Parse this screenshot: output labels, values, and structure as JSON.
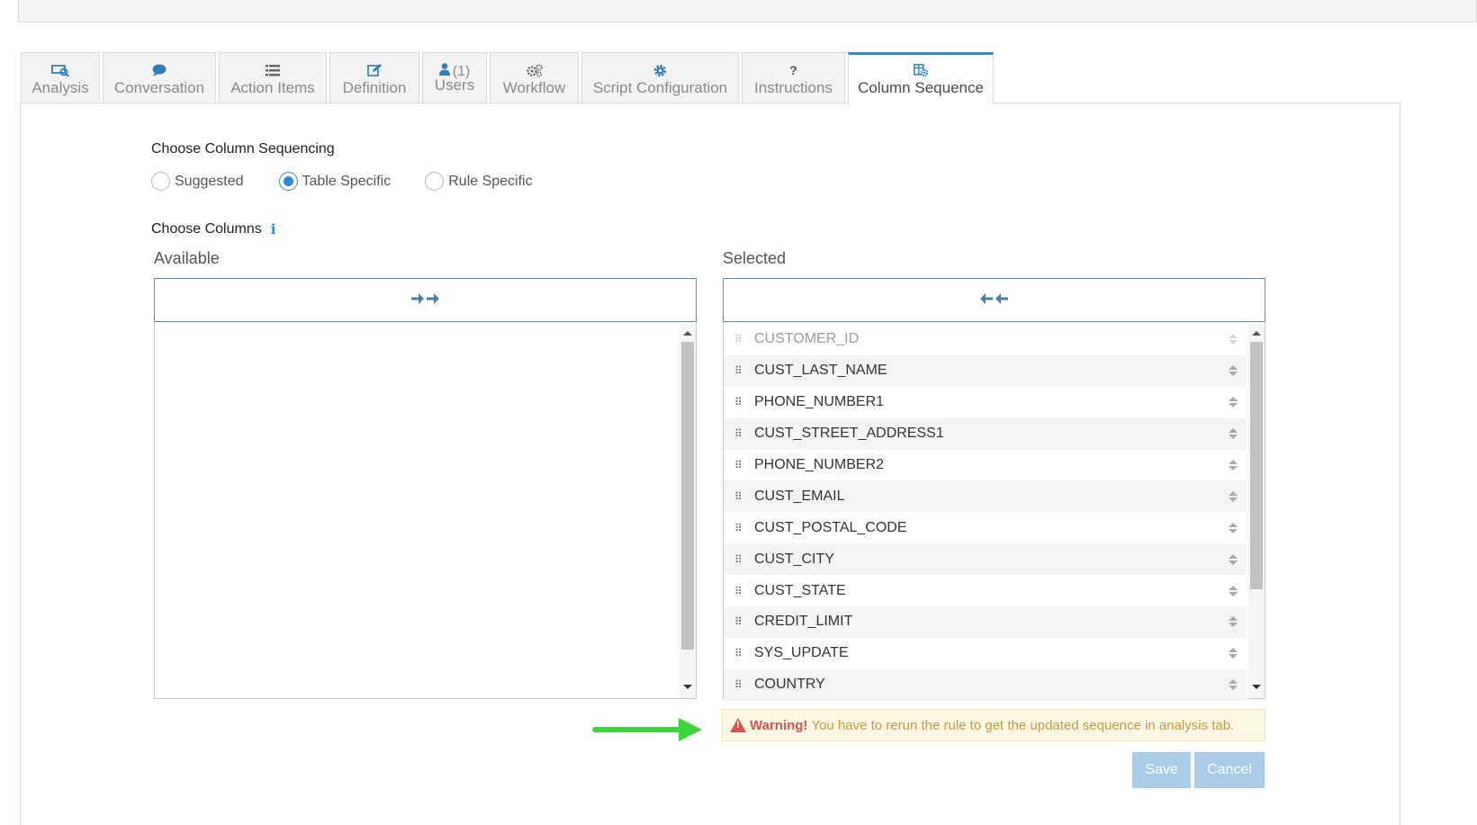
{
  "tabs": [
    {
      "label": "Analysis",
      "icon": "analysis-icon"
    },
    {
      "label": "Conversation",
      "icon": "comment-icon"
    },
    {
      "label": "Action Items",
      "icon": "list-icon"
    },
    {
      "label": "Definition",
      "icon": "edit-icon"
    },
    {
      "label": "Users",
      "icon": "user-icon",
      "count": "(1)"
    },
    {
      "label": "Workflow",
      "icon": "cogs-icon"
    },
    {
      "label": "Script Configuration",
      "icon": "gear-icon"
    },
    {
      "label": "Instructions",
      "icon": "question-icon"
    },
    {
      "label": "Column Sequence",
      "icon": "column-settings-icon",
      "active": true
    }
  ],
  "sequencing": {
    "heading": "Choose Column Sequencing",
    "options": [
      "Suggested",
      "Table Specific",
      "Rule Specific"
    ],
    "selected": "Table Specific"
  },
  "columns": {
    "heading": "Choose Columns",
    "available_label": "Available",
    "selected_label": "Selected",
    "selected_items": [
      "CUSTOMER_ID",
      "CUST_LAST_NAME",
      "PHONE_NUMBER1",
      "CUST_STREET_ADDRESS1",
      "PHONE_NUMBER2",
      "CUST_EMAIL",
      "CUST_POSTAL_CODE",
      "CUST_CITY",
      "CUST_STATE",
      "CREDIT_LIMIT",
      "SYS_UPDATE",
      "COUNTRY"
    ]
  },
  "warning": {
    "title": "Warning!",
    "message": "You have to rerun the rule to get the updated sequence in analysis tab."
  },
  "buttons": {
    "save": "Save",
    "cancel": "Cancel"
  },
  "colors": {
    "accent": "#2e8bd0",
    "warning_bg": "#fcf8e3",
    "warning_text": "#c49a45",
    "arrow": "#3ad63a"
  }
}
